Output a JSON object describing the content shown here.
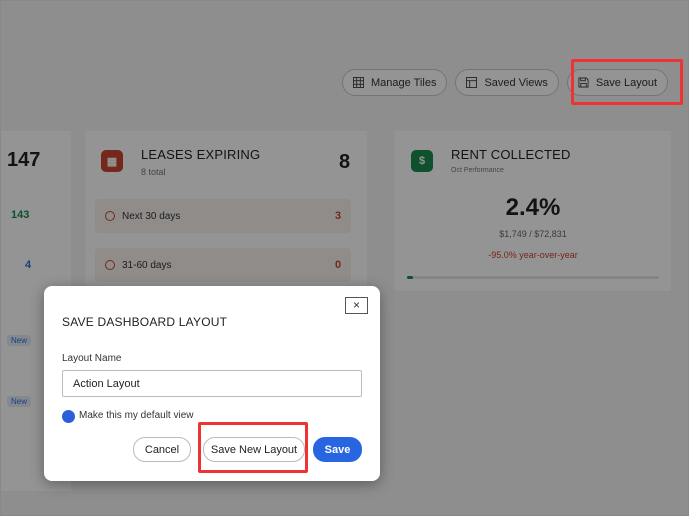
{
  "toolbar": {
    "manage_tiles": "Manage Tiles",
    "saved_views": "Saved Views",
    "save_layout": "Save Layout"
  },
  "left_card": {
    "total": "147",
    "row1_value": "143",
    "row2_value": "4",
    "tag1": "New",
    "tag2": "New"
  },
  "leases_card": {
    "title": "LEASES EXPIRING",
    "subtitle": "8 total",
    "total": "8",
    "rows": [
      {
        "label": "Next 30 days",
        "value": "3"
      },
      {
        "label": "31-60 days",
        "value": "0"
      }
    ]
  },
  "rent_card": {
    "title": "RENT COLLECTED",
    "subtitle": "Oct Performance",
    "percent": "2.4%",
    "amounts": "$1,749 / $72,831",
    "yoy": "-95.0% year-over-year"
  },
  "modal": {
    "title": "SAVE DASHBOARD LAYOUT",
    "close": "×",
    "field_label": "Layout Name",
    "field_value": "Action Layout",
    "default_label": "Make this my default view",
    "cancel": "Cancel",
    "save_new": "Save New Layout",
    "save": "Save"
  },
  "colors": {
    "accent": "#2766e0",
    "highlight": "#ee3333",
    "green": "#1a8a4e",
    "red": "#c7452f"
  }
}
